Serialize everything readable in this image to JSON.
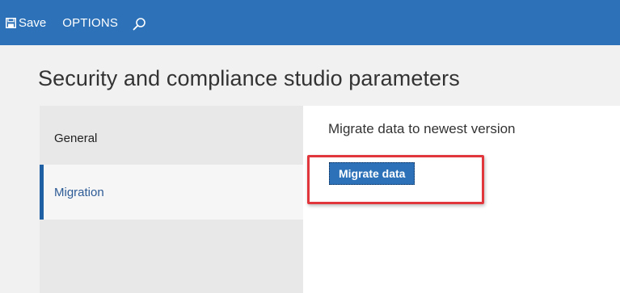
{
  "toolbar": {
    "save_label": "Save",
    "save_icon": "floppy-disk-icon",
    "options_label": "OPTIONS",
    "search_icon": "search-icon"
  },
  "page": {
    "title": "Security and compliance studio parameters"
  },
  "sidebar": {
    "items": [
      {
        "label": "General",
        "selected": false
      },
      {
        "label": "Migration",
        "selected": true
      }
    ]
  },
  "main": {
    "heading": "Migrate data to newest version",
    "migrate_button_label": "Migrate data"
  },
  "colors": {
    "toolbar_bg": "#2d72b8",
    "accent": "#1f5fa3",
    "highlight": "#e2363d"
  }
}
